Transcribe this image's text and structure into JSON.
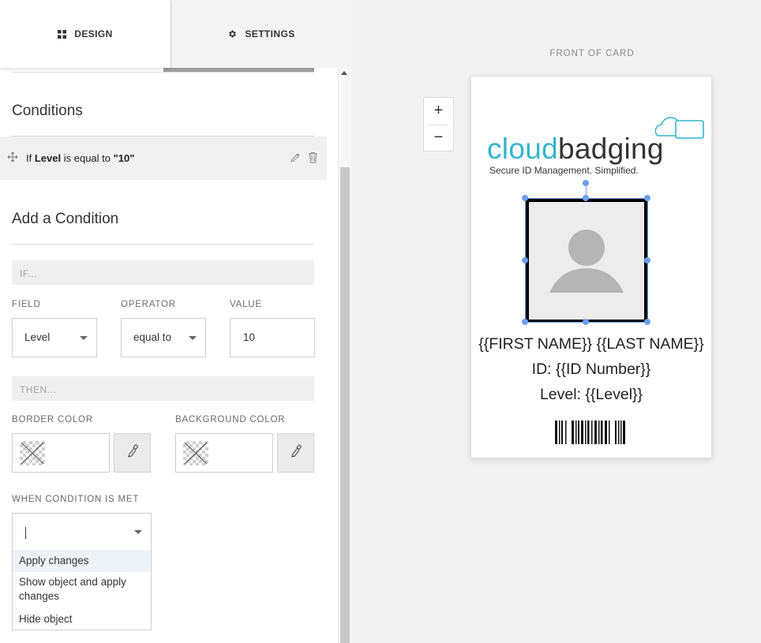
{
  "tabs": {
    "design_label": "DESIGN",
    "settings_label": "SETTINGS",
    "design_icon": "grid-icon",
    "settings_icon": "gear-icon"
  },
  "conditions": {
    "title": "Conditions",
    "items": [
      {
        "prefix": "If",
        "field": "Level",
        "middle": "is equal to",
        "value": "\"10\""
      }
    ]
  },
  "add_condition": {
    "title": "Add a Condition",
    "if_band": "IF...",
    "field_label": "FIELD",
    "operator_label": "OPERATOR",
    "value_label": "VALUE",
    "field_value": "Level",
    "operator_value": "equal to",
    "value_value": "10",
    "then_band": "THEN...",
    "border_color_label": "BORDER COLOR",
    "background_color_label": "BACKGROUND COLOR",
    "when_label": "WHEN CONDITION IS MET",
    "when_options": [
      "Apply changes",
      "Show object and apply changes",
      "Hide object"
    ]
  },
  "preview": {
    "heading": "FRONT OF CARD",
    "zoom_in": "+",
    "zoom_out": "−",
    "logo_part1": "cloud",
    "logo_part2": "badging",
    "tagline": "Secure ID Management. Simplified.",
    "name_line": "{{FIRST NAME}} {{LAST NAME}}",
    "id_line": "ID: {{ID Number}}",
    "level_line": "Level: {{Level}}"
  },
  "colors": {
    "logo_blue": "#33b5cf",
    "selection_blue": "#6d9ef5",
    "panel_bg": "#f2f2f2"
  }
}
